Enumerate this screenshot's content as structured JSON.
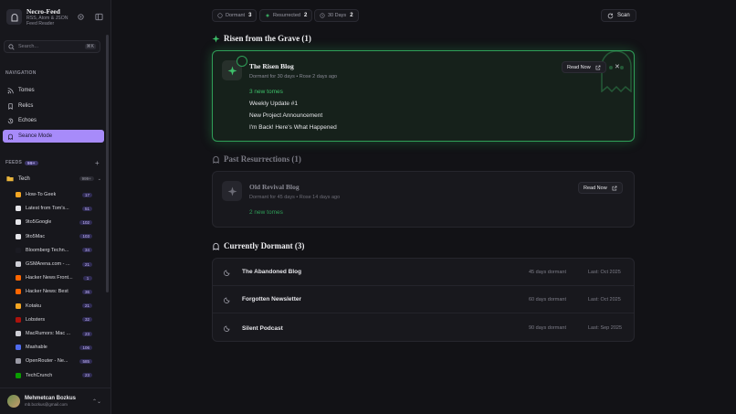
{
  "app": {
    "name": "Necro-Feed",
    "subtitle_line1": "RSS, Atom & JSON",
    "subtitle_line2": "Feed Reader"
  },
  "search": {
    "placeholder": "Search...",
    "shortcut": "⌘K"
  },
  "navigation": {
    "label": "NAVIGATION",
    "items": [
      {
        "label": "Tomes",
        "icon": "rss-icon"
      },
      {
        "label": "Relics",
        "icon": "bookmark-icon"
      },
      {
        "label": "Echoes",
        "icon": "history-icon"
      },
      {
        "label": "Seance Mode",
        "icon": "ghost-icon",
        "active": true
      }
    ]
  },
  "feeds": {
    "label": "FEEDS",
    "badge": "99+",
    "folder": {
      "name": "Tech",
      "count": "999+"
    },
    "items": [
      {
        "name": "How-To Geek",
        "count": "17",
        "color": "#f5a623"
      },
      {
        "name": "Latest from Tom's...",
        "count": "51",
        "color": "#e6e6ea"
      },
      {
        "name": "9to5Google",
        "count": "102",
        "color": "#e6e6ea"
      },
      {
        "name": "9to5Mac",
        "count": "103",
        "color": "#e6e6ea"
      },
      {
        "name": "Bloomberg Techn...",
        "count": "34",
        "color": "#1b1b22"
      },
      {
        "name": "GSMArena.com - ...",
        "count": "21",
        "color": "#cfcfd6"
      },
      {
        "name": "Hacker News Front...",
        "count": "1",
        "color": "#ff6600"
      },
      {
        "name": "Hacker News: Best",
        "count": "36",
        "color": "#ff6600"
      },
      {
        "name": "Kotaku",
        "count": "21",
        "color": "#f5a623"
      },
      {
        "name": "Lobsters",
        "count": "32",
        "color": "#ac130d"
      },
      {
        "name": "MacRumors: Mac ...",
        "count": "23",
        "color": "#cfcfd6"
      },
      {
        "name": "Mashable",
        "count": "106",
        "color": "#4f6bed"
      },
      {
        "name": "OpenRouter - Ne...",
        "count": "585",
        "color": "#9a9aa5"
      },
      {
        "name": "TechCrunch",
        "count": "23",
        "color": "#0a9e01"
      }
    ]
  },
  "user": {
    "name": "Mehmetcan Bozkus",
    "email": "mb.bozkus@gmail.com"
  },
  "stats": {
    "dormant_label": "Dormant",
    "dormant_value": "3",
    "resurrected_label": "Resurrected",
    "resurrected_value": "2",
    "window_label": "30 Days",
    "window_value": "2",
    "scan_label": "Scan"
  },
  "risen": {
    "title": "Risen from the Grave (1)",
    "card": {
      "name": "The Risen Blog",
      "meta": "Dormant for 30 days • Rose 2 days ago",
      "tomes": "3 new tomes",
      "entries": [
        "Weekly Update #1",
        "New Project Announcement",
        "I'm Back! Here's What Happened"
      ],
      "read_label": "Read Now",
      "close_label": "✕"
    }
  },
  "past": {
    "title": "Past Resurrections (1)",
    "card": {
      "name": "Old Revival Blog",
      "meta": "Dormant for 45 days • Rose 14 days ago",
      "tomes": "2 new tomes",
      "read_label": "Read Now"
    }
  },
  "dormant": {
    "title": "Currently Dormant (3)",
    "rows": [
      {
        "name": "The Abandoned Blog",
        "age": "45 days dormant",
        "last": "Last: Oct 2025"
      },
      {
        "name": "Forgotten Newsletter",
        "age": "60 days dormant",
        "last": "Last: Oct 2025"
      },
      {
        "name": "Silent Podcast",
        "age": "90 days dormant",
        "last": "Last: Sep 2025"
      }
    ]
  }
}
